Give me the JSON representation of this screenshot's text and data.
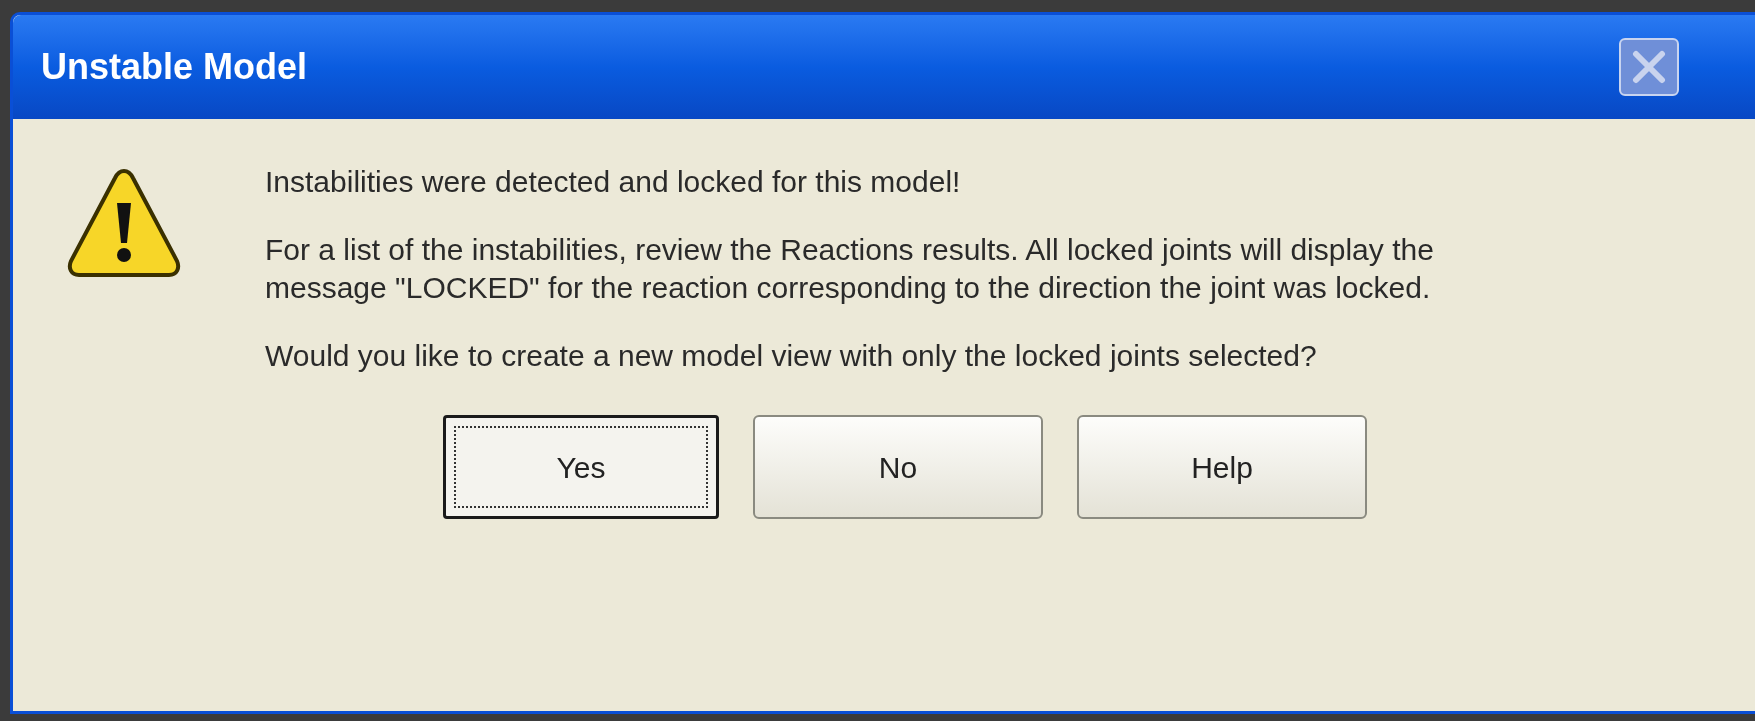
{
  "window": {
    "title": "Unstable Model"
  },
  "message": {
    "paragraphs": [
      "Instabilities were detected and locked for this model!",
      "For a list of the instabilities, review the Reactions results. All locked joints will display the message \"LOCKED\" for the reaction corresponding to the direction the joint was locked.",
      "Would you like to create a new model view with only the locked joints selected?"
    ]
  },
  "buttons": [
    {
      "label": "Yes",
      "focused": true
    },
    {
      "label": "No",
      "focused": false
    },
    {
      "label": "Help",
      "focused": false
    }
  ]
}
